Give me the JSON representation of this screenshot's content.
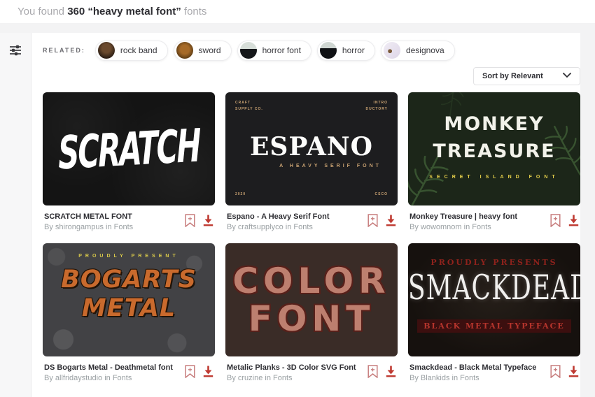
{
  "header": {
    "prefix": "You found ",
    "highlight": "360 “heavy metal font”",
    "suffix": " fonts"
  },
  "related": {
    "label": "RELATED:",
    "tags": [
      {
        "label": "rock band",
        "thumb_style": "background: radial-gradient(circle at 50% 38%, #6b4a2e 0 32%, #2e2016 72%)"
      },
      {
        "label": "sword",
        "thumb_style": "background: radial-gradient(circle at 50% 45%, #a66a28 0 35%, #5a3a14 75%)"
      },
      {
        "label": "horror font",
        "thumb_style": "background: linear-gradient(#d7ded9 0 42%, #15171a 42%)"
      },
      {
        "label": "horror",
        "thumb_style": "background: linear-gradient(#cfd6d2 0 38%, #101215 38%)"
      },
      {
        "label": "designova",
        "thumb_style": "background: radial-gradient(circle at 38% 55%, #7a5a3a 0 14%, transparent 15%), linear-gradient(135deg, #f0ecf4, #ded6e8)"
      }
    ]
  },
  "sort": {
    "selected": "Sort by Relevant"
  },
  "cards": [
    {
      "title": "SCRATCH METAL FONT",
      "byline": "By shirongampus in Fonts",
      "preview": {
        "word": "SCRATCH"
      }
    },
    {
      "title": "Espano - A Heavy Serif Font",
      "byline": "By craftsupplyco in Fonts",
      "preview": {
        "top_left": "CRAFT\nSUPPLY CO.",
        "top_right": "INTRO\nDUCTORY",
        "word": "ESPANO",
        "subtitle": "A HEAVY SERIF FONT",
        "bottom_left": "2020",
        "bottom_right": "CSCO"
      }
    },
    {
      "title": "Monkey Treasure | heavy font",
      "byline": "By wowomnom in Fonts",
      "preview": {
        "line1": "MONKEY",
        "line2": "TREASURE",
        "subtitle": "SECRET ISLAND FONT"
      }
    },
    {
      "title": "DS Bogarts Metal - Deathmetal font",
      "byline": "By allfridaystudio in Fonts",
      "preview": {
        "kicker": "PROUDLY PRESENT",
        "line1": "BOGARTS",
        "line2": "METAL"
      }
    },
    {
      "title": "Metalic Planks - 3D Color SVG Font",
      "byline": "By cruzine in Fonts",
      "preview": {
        "line1": "COLOR",
        "line2": "FONT"
      }
    },
    {
      "title": "Smackdead - Black Metal Typeface",
      "byline": "By Blankids in Fonts",
      "preview": {
        "kicker": "PROUDLY PRESENTS",
        "word": "SMACKDEAD",
        "subtitle": "BLACK METAL TYPEFACE"
      }
    }
  ],
  "colors": {
    "accent_download": "#bf3a32",
    "accent_bookmark": "#c77d7d",
    "title_text": "#2e2e33",
    "muted_text": "#9aa0a3",
    "page_bg": "#f3f3f4",
    "panel_bg": "#ffffff",
    "espano_gold": "#c9a272",
    "monkey_yellow": "#e5cf4a",
    "bogarts_orange": "#c96a2d",
    "smack_red": "#b5342c"
  }
}
